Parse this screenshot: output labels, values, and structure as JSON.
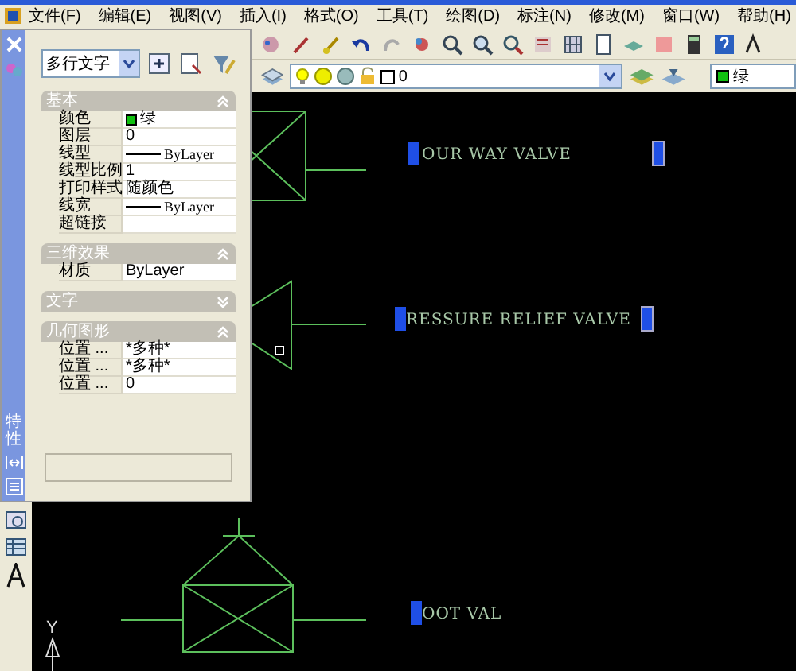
{
  "menu": [
    {
      "label": "文件(F)"
    },
    {
      "label": "编辑(E)"
    },
    {
      "label": "视图(V)"
    },
    {
      "label": "插入(I)"
    },
    {
      "label": "格式(O)"
    },
    {
      "label": "工具(T)"
    },
    {
      "label": "绘图(D)"
    },
    {
      "label": "标注(N)"
    },
    {
      "label": "修改(M)"
    },
    {
      "label": "窗口(W)"
    },
    {
      "label": "帮助(H)"
    }
  ],
  "layer_dropdown": {
    "value": "0"
  },
  "color_dropdown": {
    "value": "绿",
    "color": "#10c010"
  },
  "palette": {
    "title": "特性",
    "object_type": "多行文字",
    "sections": [
      {
        "title": "基本",
        "expanded": true,
        "rows": [
          {
            "label": "颜色",
            "value": "绿",
            "kind": "color",
            "color": "#10c010"
          },
          {
            "label": "图层",
            "value": "0",
            "kind": "text"
          },
          {
            "label": "线型",
            "value": "ByLayer",
            "kind": "line"
          },
          {
            "label": "线型比例",
            "value": "1",
            "kind": "text"
          },
          {
            "label": "打印样式",
            "value": "随颜色",
            "kind": "text"
          },
          {
            "label": "线宽",
            "value": "ByLayer",
            "kind": "line"
          },
          {
            "label": "超链接",
            "kind": "text"
          }
        ]
      },
      {
        "title": "三维效果",
        "expanded": true,
        "rows": [
          {
            "label": "材质",
            "value": "ByLayer",
            "kind": "text"
          }
        ]
      },
      {
        "title": "文字",
        "expanded": false
      },
      {
        "title": "几何图形",
        "expanded": true,
        "rows": [
          {
            "label": "位置 ...",
            "value": "*多种*",
            "kind": "text"
          },
          {
            "label": "位置 ...",
            "value": "*多种*",
            "kind": "text"
          },
          {
            "label": "位置 ...",
            "value": "0",
            "kind": "text"
          }
        ]
      }
    ]
  },
  "drawing": {
    "labels": [
      {
        "text": "OUR WAY VALVE"
      },
      {
        "text": "RESSURE RELIEF VALVE"
      },
      {
        "text": "OOT VAL"
      }
    ],
    "axis_label": "Y"
  }
}
